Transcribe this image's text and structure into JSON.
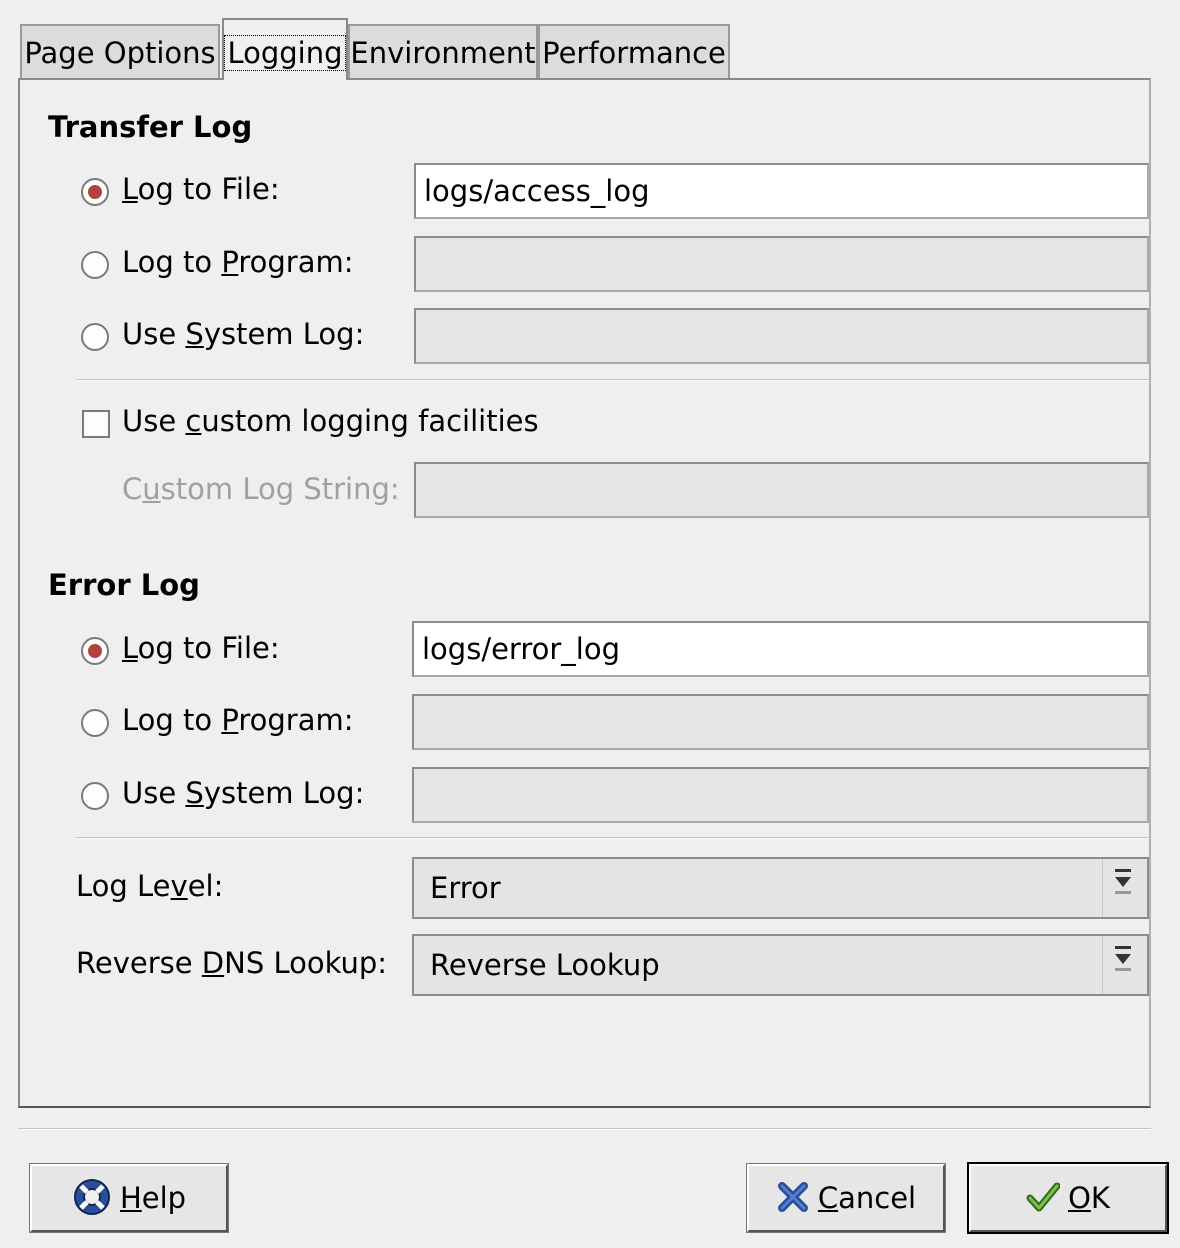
{
  "tabs": [
    {
      "label": "Page Options",
      "active": false
    },
    {
      "label": "Logging",
      "active": true
    },
    {
      "label": "Environment",
      "active": false
    },
    {
      "label": "Performance",
      "active": false
    }
  ],
  "transfer_log": {
    "title": "Transfer Log",
    "log_to_file": {
      "label_pre": "",
      "mnemonic": "L",
      "label_post": "og to File:",
      "checked": true,
      "value": "logs/access_log"
    },
    "log_to_program": {
      "label_pre": "Log to ",
      "mnemonic": "P",
      "label_post": "rogram:",
      "checked": false,
      "value": ""
    },
    "use_system_log": {
      "label_pre": "Use ",
      "mnemonic": "S",
      "label_post": "ystem Log:",
      "checked": false,
      "value": ""
    },
    "custom_logging": {
      "label_pre": "Use ",
      "mnemonic": "c",
      "label_post": "ustom logging facilities",
      "checked": false
    },
    "custom_log_string": {
      "label_pre": "C",
      "mnemonic": "u",
      "label_post": "stom Log String:",
      "value": ""
    }
  },
  "error_log": {
    "title": "Error Log",
    "log_to_file": {
      "label_pre": "",
      "mnemonic": "L",
      "label_post": "og to File:",
      "checked": true,
      "value": "logs/error_log"
    },
    "log_to_program": {
      "label_pre": "Log to ",
      "mnemonic": "P",
      "label_post": "rogram:",
      "checked": false,
      "value": ""
    },
    "use_system_log": {
      "label_pre": "Use ",
      "mnemonic": "S",
      "label_post": "ystem Log:",
      "checked": false,
      "value": ""
    }
  },
  "log_level": {
    "label_pre": "Log Le",
    "mnemonic": "v",
    "label_post": "el:",
    "selected": "Error"
  },
  "reverse_dns": {
    "label_pre": "Reverse ",
    "mnemonic": "D",
    "label_post": "NS Lookup:",
    "selected": "Reverse Lookup"
  },
  "buttons": {
    "help": {
      "mnemonic": "H",
      "rest": "elp",
      "icon": "help-lifebuoy-icon"
    },
    "cancel": {
      "mnemonic": "C",
      "rest": "ancel",
      "icon": "cancel-x-icon"
    },
    "ok": {
      "mnemonic": "O",
      "rest": "K",
      "icon": "ok-check-icon"
    }
  },
  "colors": {
    "radio_checked": "#b0433a",
    "cancel_icon": "#2a4f9a",
    "ok_icon": "#4a9a2a",
    "help_icon": "#2a4f9a"
  }
}
